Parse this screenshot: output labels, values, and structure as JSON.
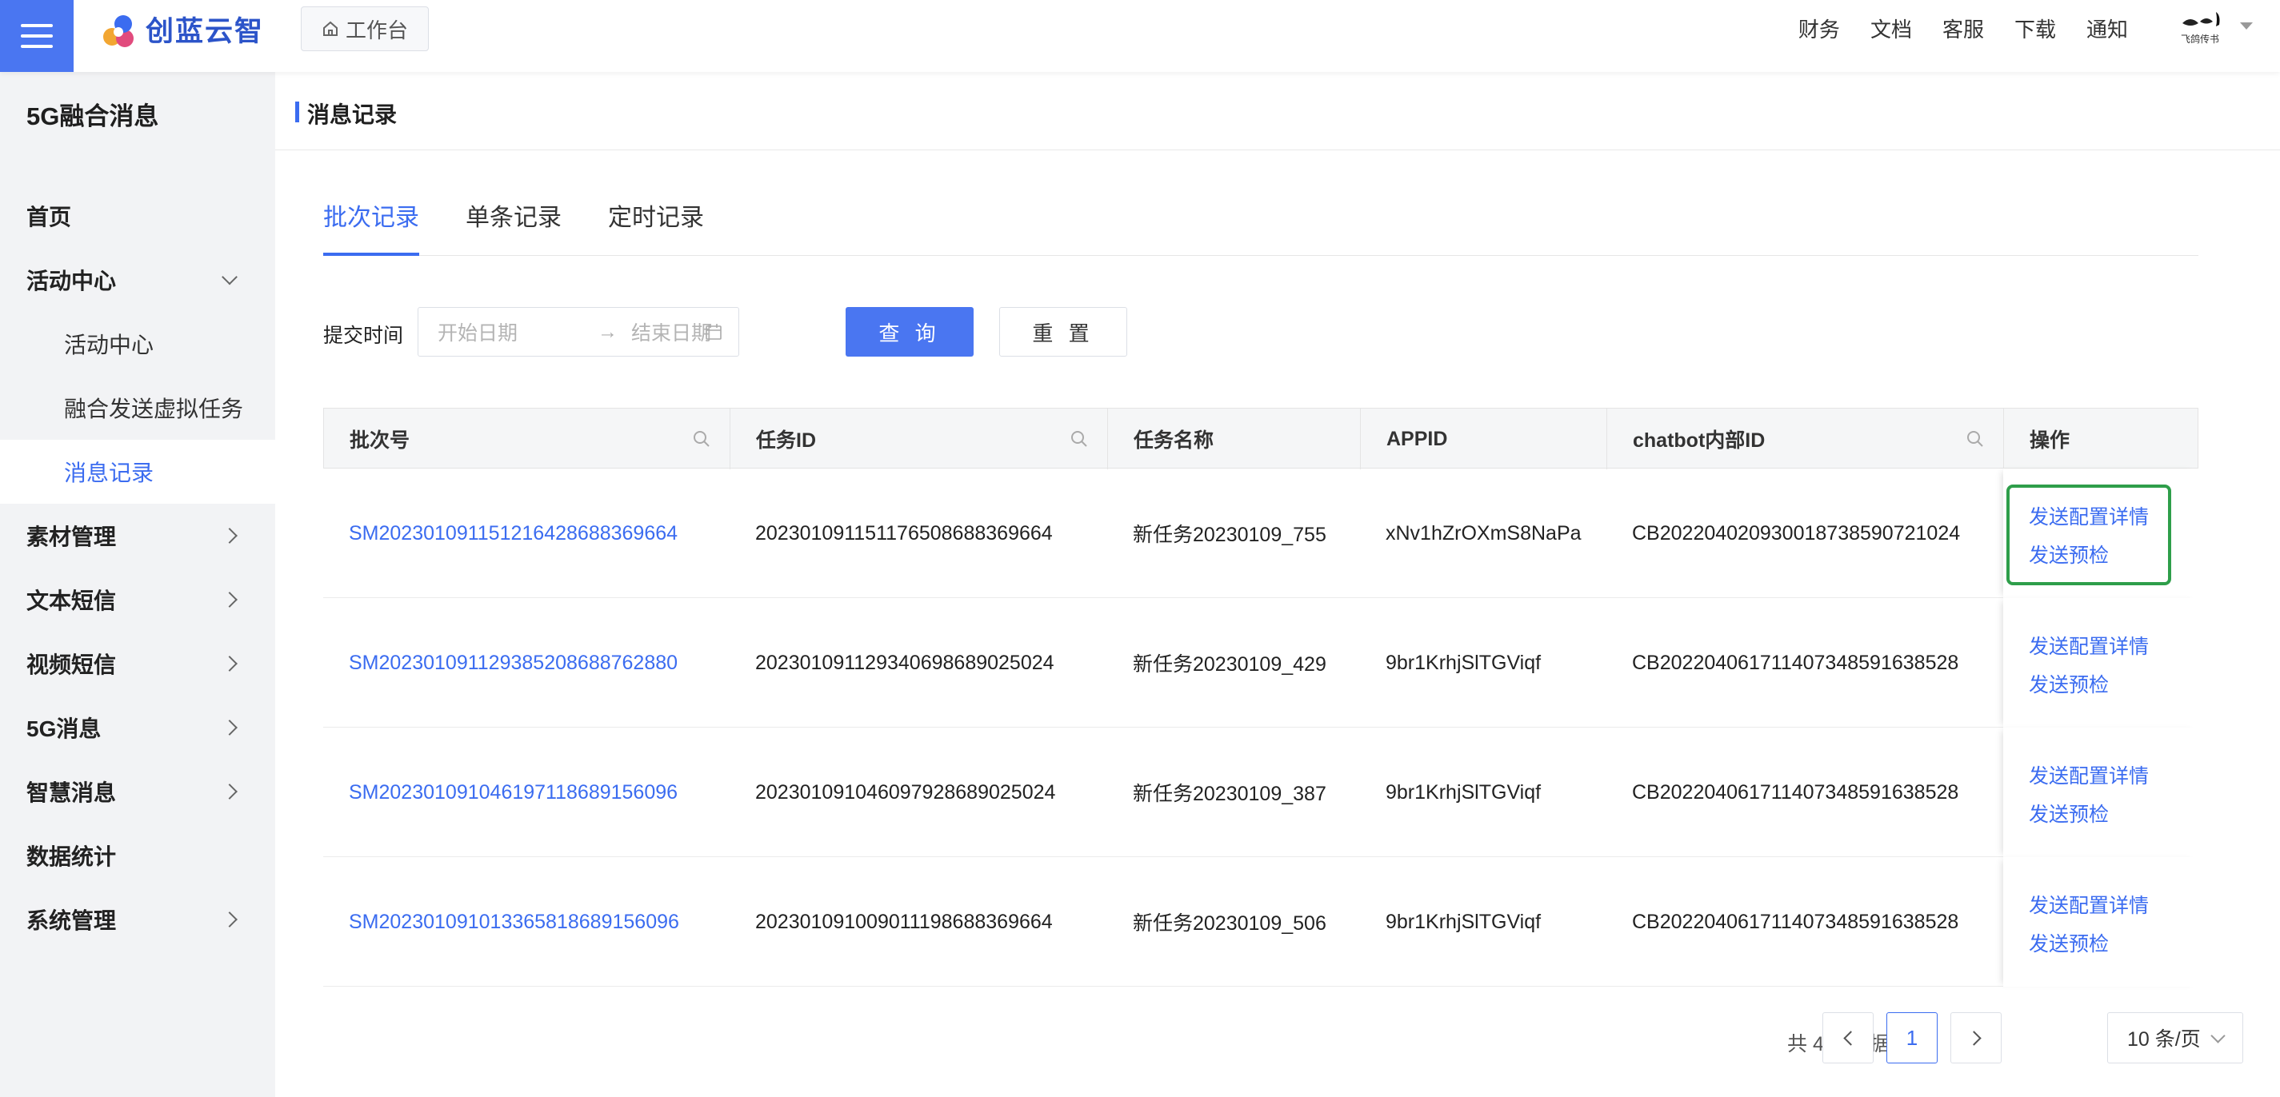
{
  "header": {
    "logo_text": "创蓝云智",
    "workbench_label": "工作台",
    "nav": [
      "财务",
      "文档",
      "客服",
      "下载",
      "通知"
    ],
    "avatar_text": "飞鸽传书",
    "accent_color": "#4a76f1"
  },
  "sidebar": {
    "title": "5G融合消息",
    "items": [
      {
        "label": "首页"
      },
      {
        "label": "活动中心",
        "expanded": true
      },
      {
        "label": "活动中心"
      },
      {
        "label": "融合发送虚拟任务"
      },
      {
        "label": "消息记录",
        "active": true
      },
      {
        "label": "素材管理"
      },
      {
        "label": "文本短信"
      },
      {
        "label": "视频短信"
      },
      {
        "label": "5G消息"
      },
      {
        "label": "智慧消息"
      },
      {
        "label": "数据统计"
      },
      {
        "label": "系统管理"
      }
    ]
  },
  "page": {
    "title": "消息记录",
    "tabs": [
      "批次记录",
      "单条记录",
      "定时记录"
    ],
    "active_tab": "批次记录"
  },
  "filter": {
    "label": "提交时间",
    "start_placeholder": "开始日期",
    "arrow": "→",
    "end_placeholder": "结束日期",
    "query_label": "查 询",
    "reset_label": "重 置"
  },
  "table": {
    "columns": [
      "批次号",
      "任务ID",
      "任务名称",
      "APPID",
      "chatbot内部ID",
      "操作"
    ],
    "rows": [
      {
        "batch": "SM20230109115121642868836966 4",
        "task_id": "20230109115117650868836966 4",
        "task_name": "新任务20230109_755",
        "appid": "xNv1hZrOXmS8NaPa",
        "chatbot_id": "CB20220402093001873859072102 4"
      }
    ],
    "op_detail": "发送配置详情",
    "op_precheck": "发送预检"
  },
  "pagination": {
    "total": "共 4 条数据",
    "current_page": "1",
    "page_size": "10 条/页"
  }
}
